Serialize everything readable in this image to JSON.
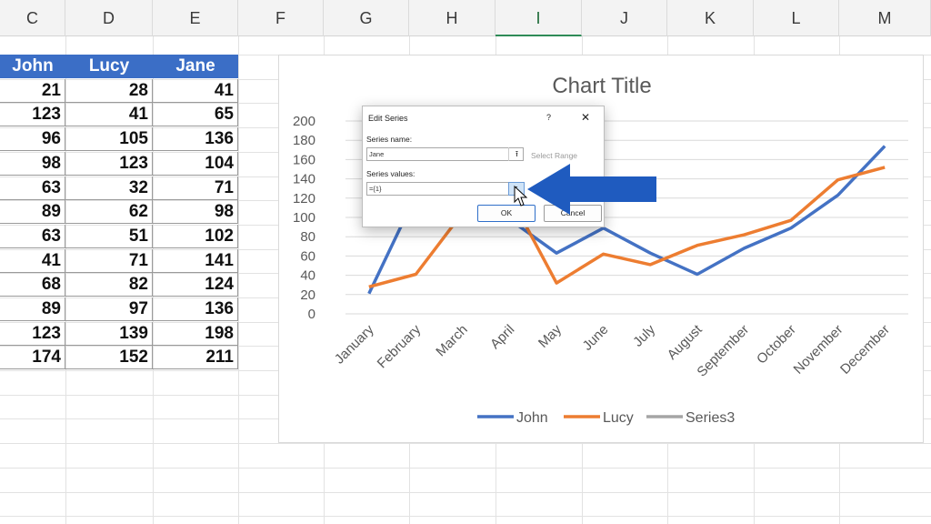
{
  "columns": [
    "C",
    "D",
    "E",
    "F",
    "G",
    "H",
    "I",
    "J",
    "K",
    "L",
    "M"
  ],
  "active_column": "I",
  "table": {
    "headers": [
      "John",
      "Lucy",
      "Jane"
    ],
    "rows": [
      [
        21,
        28,
        41
      ],
      [
        123,
        41,
        65
      ],
      [
        96,
        105,
        136
      ],
      [
        98,
        123,
        104
      ],
      [
        63,
        32,
        71
      ],
      [
        89,
        62,
        98
      ],
      [
        63,
        51,
        102
      ],
      [
        41,
        71,
        141
      ],
      [
        68,
        82,
        124
      ],
      [
        89,
        97,
        136
      ],
      [
        123,
        139,
        198
      ],
      [
        174,
        152,
        211
      ]
    ]
  },
  "chart_data": {
    "type": "line",
    "title": "Chart Title",
    "x": [
      "January",
      "February",
      "March",
      "April",
      "May",
      "June",
      "July",
      "August",
      "September",
      "October",
      "November",
      "December"
    ],
    "ylim": [
      0,
      200
    ],
    "yticks": [
      0,
      20,
      40,
      60,
      80,
      100,
      120,
      140,
      160,
      180,
      200
    ],
    "grid": true,
    "legend_position": "bottom",
    "series": [
      {
        "name": "John",
        "color": "#4472c4",
        "values": [
          21,
          123,
          96,
          98,
          63,
          89,
          63,
          41,
          68,
          89,
          123,
          174
        ]
      },
      {
        "name": "Lucy",
        "color": "#ed7d31",
        "values": [
          28,
          41,
          105,
          123,
          32,
          62,
          51,
          71,
          82,
          97,
          139,
          152
        ]
      },
      {
        "name": "Series3",
        "color": "#a5a5a5",
        "values": []
      }
    ]
  },
  "dialog": {
    "title": "Edit Series",
    "help": "?",
    "close": "✕",
    "series_name_label": "Series name:",
    "series_name_value": "Jane",
    "select_range_hint": "Select Range",
    "series_values_label": "Series values:",
    "series_values_value": "={1}",
    "range_icon": "⭱",
    "ok_label": "OK",
    "cancel_label": "Cancel"
  },
  "annotation": {
    "arrow_color": "#1f5bbf"
  }
}
